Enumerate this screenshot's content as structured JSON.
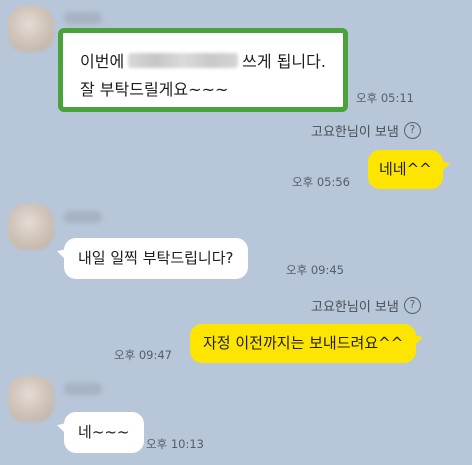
{
  "chat": {
    "messages": [
      {
        "direction": "incoming",
        "text_before": "이번에",
        "text_after": "쓰게 됩니다.",
        "line2": "잘 부탁드릴게요~~~",
        "time": "오후 05:11"
      },
      {
        "direction": "outgoing",
        "sent_by": "고요한님이 보냄",
        "text": "네네^^",
        "time": "오후 05:56"
      },
      {
        "direction": "incoming",
        "text": "내일 일찍 부탁드립니다?",
        "time": "오후 09:45"
      },
      {
        "direction": "outgoing",
        "sent_by": "고요한님이 보냄",
        "text": "자정 이전까지는 보내드려요^^",
        "time": "오후 09:47"
      },
      {
        "direction": "incoming",
        "text": "네~~~",
        "time": "오후 10:13"
      }
    ],
    "help_glyph": "?"
  },
  "colors": {
    "background": "#b7c6d8",
    "incoming_bubble": "#ffffff",
    "outgoing_bubble": "#fee500",
    "highlight_border": "#4aa23a"
  },
  "icons": {
    "help": "question-circle-icon"
  }
}
